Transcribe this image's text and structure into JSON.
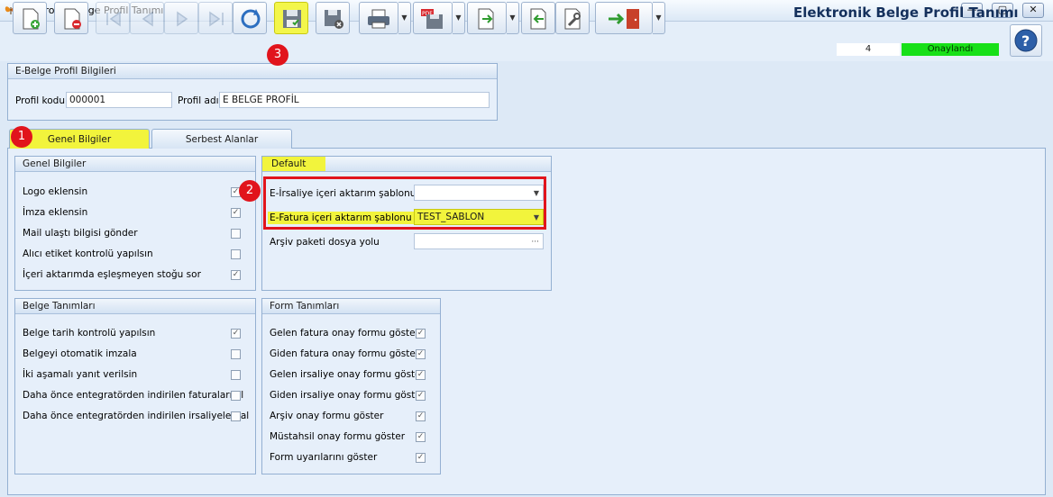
{
  "window": {
    "title": "Elektronik Belge Profil Tanımı",
    "controls": {
      "minimize": "—",
      "maximize": "▢",
      "close": "✕"
    }
  },
  "toolbar": {
    "icons": [
      "new-doc-icon",
      "delete-doc-icon",
      "first-record-icon",
      "prev-record-icon",
      "next-record-icon",
      "last-record-icon",
      "refresh-icon",
      "save-icon",
      "save-close-icon",
      "print-icon",
      "pdf-save-icon",
      "export-icon",
      "import-icon",
      "tools-icon",
      "exit-icon"
    ],
    "highlight_color": "#f3f64a"
  },
  "header": {
    "doc_title": "Elektronik Belge Profil Tanımı",
    "record_number": "4",
    "status": "Onaylandı",
    "status_color": "#18e018"
  },
  "profile": {
    "panel_title": "E-Belge Profil Bilgileri",
    "code_label": "Profil kodu",
    "code_value": "000001",
    "name_label": "Profil adı",
    "name_value": "E BELGE PROFİL"
  },
  "tabs": [
    {
      "label": "Genel Bilgiler",
      "active": true
    },
    {
      "label": "Serbest Alanlar",
      "active": false
    }
  ],
  "genel": {
    "title": "Genel Bilgiler",
    "items": [
      {
        "label": "Logo eklensin",
        "checked": true
      },
      {
        "label": "İmza eklensin",
        "checked": true
      },
      {
        "label": "Mail ulaştı bilgisi gönder",
        "checked": false
      },
      {
        "label": "Alıcı etiket kontrolü yapılsın",
        "checked": false
      },
      {
        "label": "İçeri aktarımda eşleşmeyen stoğu sor",
        "checked": true
      }
    ]
  },
  "default": {
    "title": "Default",
    "irsaliye_label": "E-İrsaliye içeri aktarım şablonu",
    "irsaliye_value": "",
    "fatura_label": "E-Fatura içeri aktarım şablonu",
    "fatura_value": "TEST_SABLON",
    "arsiv_label": "Arşiv paketi dosya yolu",
    "arsiv_value": "",
    "ellipsis": "···"
  },
  "belge": {
    "title": "Belge Tanımları",
    "items": [
      {
        "label": "Belge tarih kontrolü yapılsın",
        "checked": true
      },
      {
        "label": "Belgeyi otomatik imzala",
        "checked": false
      },
      {
        "label": "İki aşamalı yanıt verilsin",
        "checked": false
      },
      {
        "label": "Daha önce entegratörden indirilen faturaları al",
        "checked": false
      },
      {
        "label": "Daha önce entegratörden indirilen irsaliyeleri al",
        "checked": false
      }
    ]
  },
  "form": {
    "title": "Form Tanımları",
    "items": [
      {
        "label": "Gelen fatura onay formu göster",
        "checked": true
      },
      {
        "label": "Giden fatura onay formu göster",
        "checked": true
      },
      {
        "label": "Gelen irsaliye onay formu göster",
        "checked": true
      },
      {
        "label": "Giden irsaliye onay formu göster",
        "checked": true
      },
      {
        "label": "Arşiv onay formu göster",
        "checked": true
      },
      {
        "label": "Müstahsil onay formu göster",
        "checked": true
      },
      {
        "label": "Form uyarılarını göster",
        "checked": true
      }
    ]
  },
  "markers": [
    "1",
    "2",
    "3"
  ]
}
